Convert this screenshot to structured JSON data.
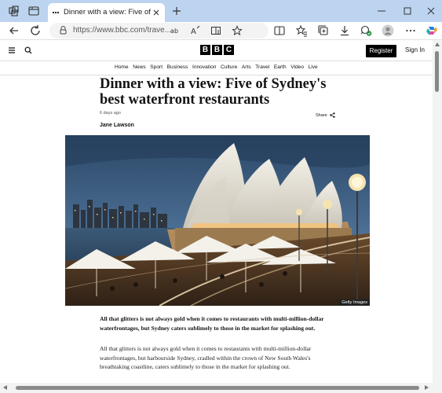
{
  "browser": {
    "tab_title": "Dinner with a view: Five of Sydney's best waterfront restaurants",
    "url": "https://www.bbc.com/trave...",
    "accent_color": "#bcd4ef"
  },
  "site": {
    "logo_letters": [
      "B",
      "B",
      "C"
    ],
    "register_label": "Register",
    "signin_label": "Sign In",
    "nav_items": [
      "Home",
      "News",
      "Sport",
      "Business",
      "Innovation",
      "Culture",
      "Arts",
      "Travel",
      "Earth",
      "Video",
      "Live"
    ]
  },
  "article": {
    "headline": "Dinner with a view: Five of Sydney's best waterfront restaurants",
    "timestamp": "6 days ago",
    "share_label": "Share",
    "author": "Jane Lawson",
    "image_credit": "Getty Images",
    "intro": "All that glitters is not always gold when it comes to restaurants with multi-million-dollar waterfrontages, but Sydney caters sublimely to those in the market for splashing out.",
    "body_paragraph": "All that glitters is not always gold when it comes to restaurants with multi-million-dollar waterfrontages, but harbourside Sydney, cradled within the crown of New South Wales's breathtaking coastline, caters sublimely to those in the market for splashing out."
  },
  "icons": [
    "workspaces-icon",
    "tab-actions-icon",
    "tab-favicon",
    "close-icon",
    "plus-icon",
    "minimize-icon",
    "maximize-icon",
    "close-window-icon",
    "back-icon",
    "refresh-icon",
    "info-icon",
    "read-aloud-icon",
    "text-size-icon",
    "immersive-reader-icon",
    "star-icon",
    "split-screen-icon",
    "favorites-icon",
    "collections-icon",
    "download-icon",
    "shield-check-icon",
    "profile-icon",
    "more-icon",
    "copilot-icon",
    "menu-icon",
    "search-icon",
    "share-icon"
  ]
}
